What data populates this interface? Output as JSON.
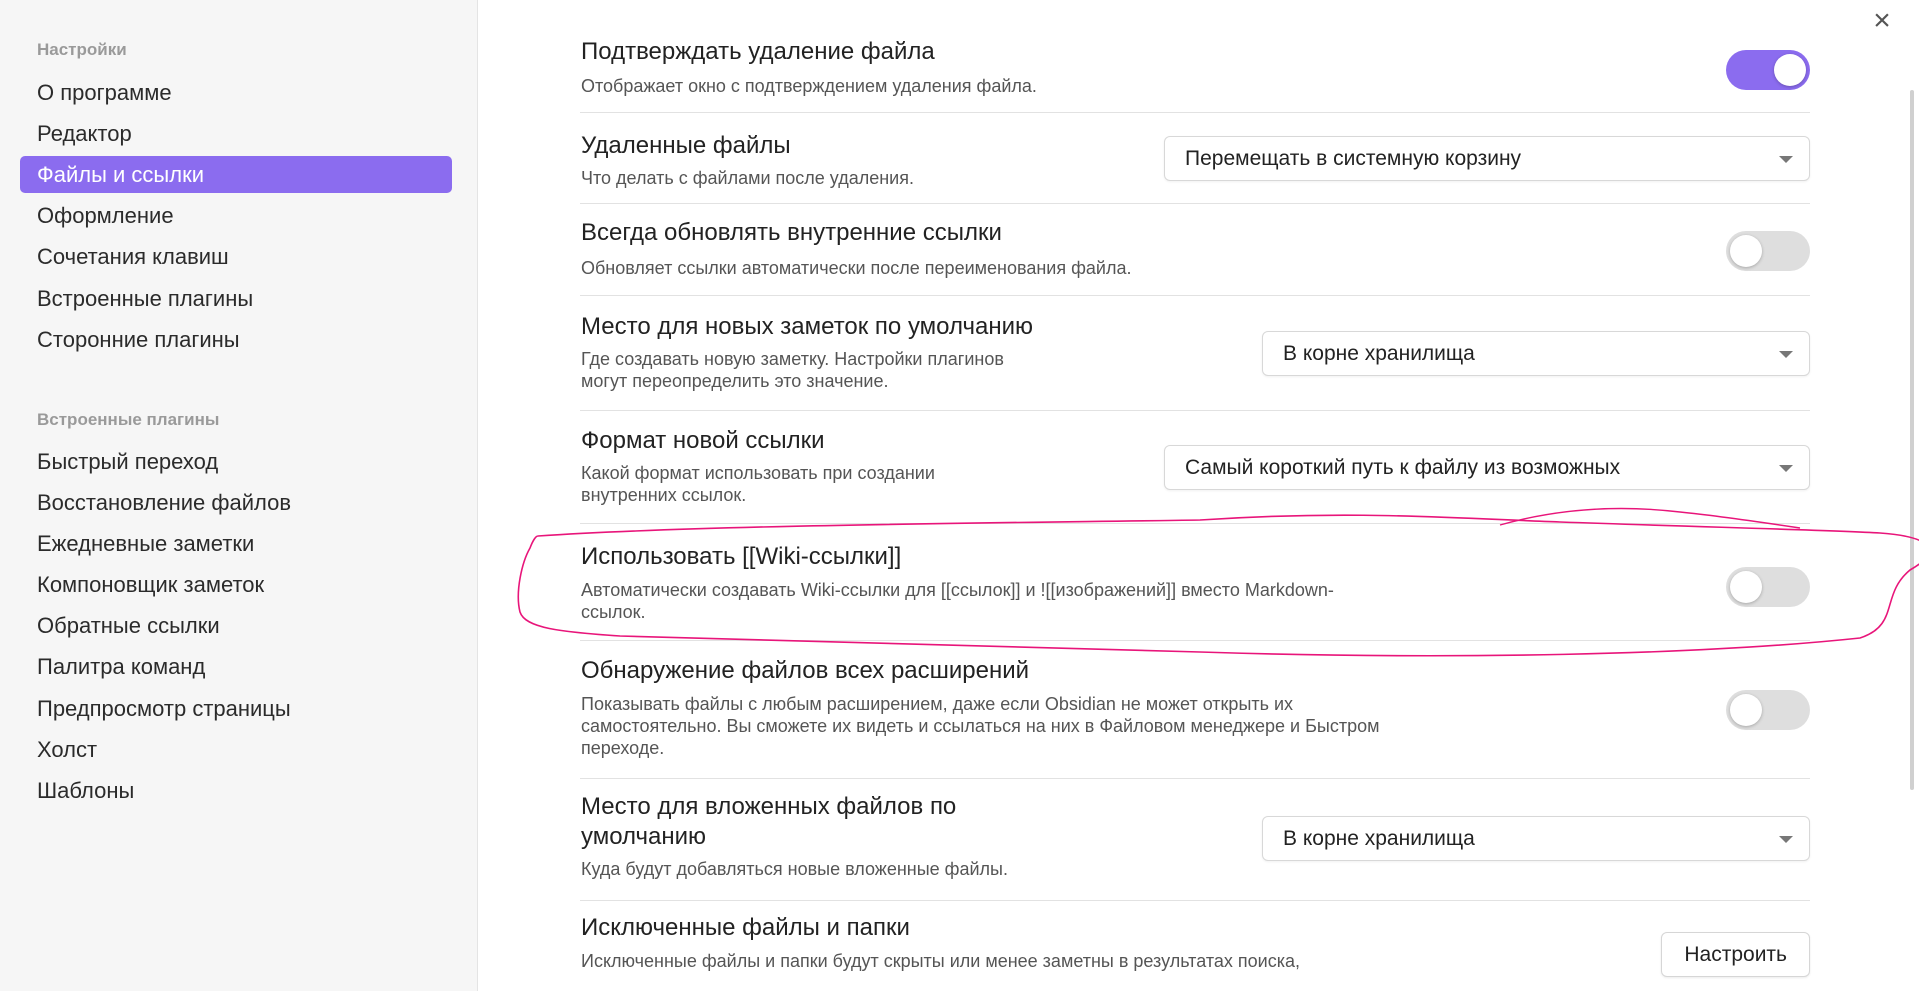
{
  "sidebar": {
    "section1_title": "Настройки",
    "items1": [
      "О программе",
      "Редактор",
      "Файлы и ссылки",
      "Оформление",
      "Сочетания клавиш",
      "Встроенные плагины",
      "Сторонние плагины"
    ],
    "section2_title": "Встроенные плагины",
    "items2": [
      "Быстрый переход",
      "Восстановление файлов",
      "Ежедневные заметки",
      "Компоновщик заметок",
      "Обратные ссылки",
      "Палитра команд",
      "Предпросмотр страницы",
      "Холст",
      "Шаблоны"
    ]
  },
  "close_icon": "×",
  "settings": {
    "confirm_delete": {
      "name": "Подтверждать удаление файла",
      "desc": "Отображает окно с подтверждением удаления файла.",
      "enabled": true
    },
    "deleted_files": {
      "name": "Удаленные файлы",
      "desc": "Что делать с файлами после удаления.",
      "value": "Перемещать в системную корзину"
    },
    "auto_update_links": {
      "name": "Всегда обновлять внутренние ссылки",
      "desc": "Обновляет ссылки автоматически после переименования файла.",
      "enabled": false
    },
    "new_note_location": {
      "name": "Место для новых заметок по умолчанию",
      "desc1": "Где создавать новую заметку. Настройки плагинов",
      "desc2": "могут переопределить это значение.",
      "value": "В корне хранилища"
    },
    "new_link_format": {
      "name": "Формат новой ссылки",
      "desc1": "Какой формат использовать при создании",
      "desc2": "внутренних ссылок.",
      "value": "Самый короткий путь к файлу из возможных"
    },
    "use_wikilinks": {
      "name": "Использовать [[Wiki-ссылки]]",
      "desc1": "Автоматически создавать Wiki-ссылки для [[ссылок]] и ![[изображений]] вместо Markdown-",
      "desc2": "ссылок.",
      "enabled": false
    },
    "detect_all_extensions": {
      "name": "Обнаружение файлов всех расширений",
      "desc1": "Показывать файлы с любым расширением, даже если Obsidian не может открыть их",
      "desc2": "самостоятельно. Вы сможете их видеть и ссылаться на них в Файловом менеджере и Быстром",
      "desc3": "переходе.",
      "enabled": false
    },
    "attachment_location": {
      "name1": "Место для вложенных файлов по",
      "name2": "умолчанию",
      "desc": "Куда будут добавляться новые вложенные файлы.",
      "value": "В корне хранилища"
    },
    "excluded_files": {
      "name": "Исключенные файлы и папки",
      "desc": "Исключенные файлы и папки будут скрыты или менее заметны в результатах поиска,",
      "button": "Настроить"
    }
  },
  "colors": {
    "accent": "#8b6cef",
    "highlight_marker": "#e8157a"
  }
}
